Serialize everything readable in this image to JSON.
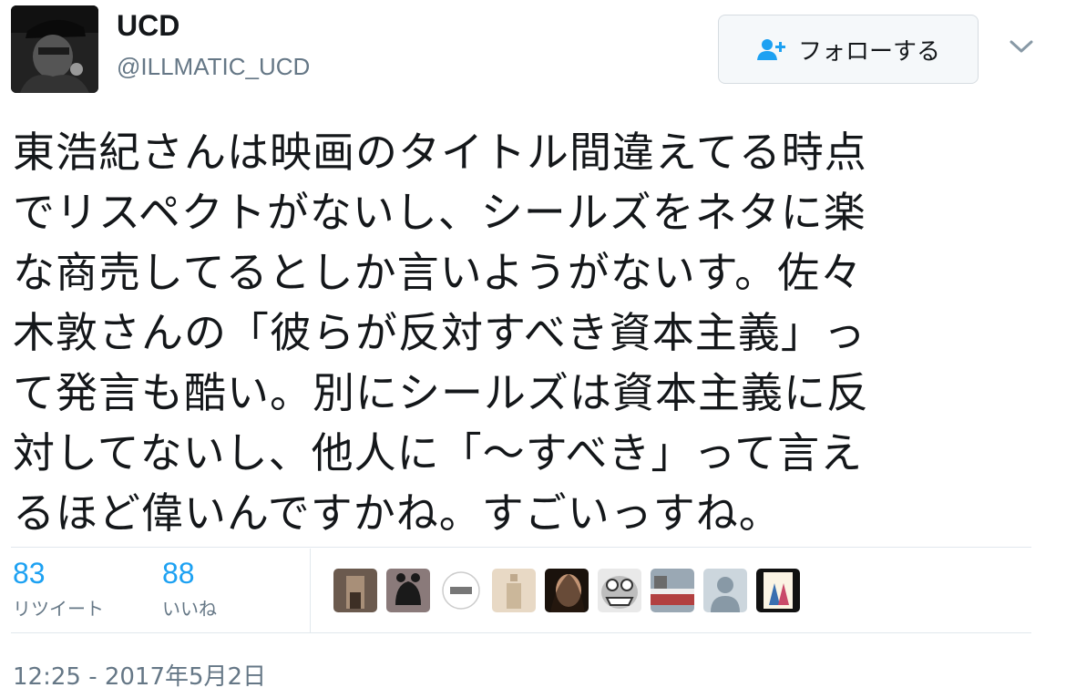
{
  "user": {
    "name": "UCD",
    "handle": "@ILLMATIC_UCD"
  },
  "follow_button": {
    "label": "フォローする",
    "icon": "person-plus-icon"
  },
  "menu": {
    "icon": "chevron-down-icon"
  },
  "tweet": {
    "text": "東浩紀さんは映画のタイトル間違えてる時点\nでリスペクトがないし、シールズをネタに楽\nな商売してるとしか言いようがないす。佐々\n木敦さんの「彼らが反対すべき資本主義」っ\nて発言も酷い。別にシールズは資本主義に反\n対してないし、他人に「〜すべき」って言え\nるほど偉いんですかね。すごいっすね。"
  },
  "stats": {
    "retweets": {
      "count": "83",
      "label": "リツイート"
    },
    "likes": {
      "count": "88",
      "label": "いいね"
    }
  },
  "likers_count": 9,
  "timestamp": "12:25 - 2017年5月2日",
  "colors": {
    "accent": "#1da1f2",
    "muted": "#657786",
    "border": "#e1e8ed"
  }
}
